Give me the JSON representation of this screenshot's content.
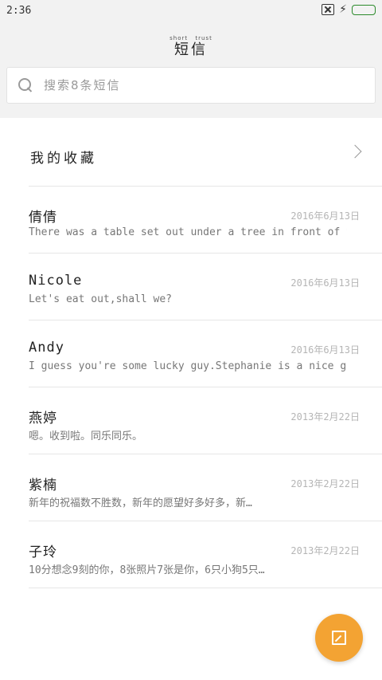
{
  "status_bar": {
    "time": "2:36"
  },
  "header": {
    "title": "短信",
    "title_ruby": "short trust"
  },
  "search": {
    "placeholder": "搜索8条短信"
  },
  "favorites": {
    "label": "我的收藏"
  },
  "messages": [
    {
      "name": "倩倩",
      "date": "2016年6月13日",
      "preview": "There was a table set out under a tree in front of the hous"
    },
    {
      "name": "Nicole",
      "date": "2016年6月13日",
      "preview": "Let's eat out,shall we?"
    },
    {
      "name": "Andy",
      "date": "2016年6月13日",
      "preview": "I guess you're some lucky guy.Stephanie is a nice girl."
    },
    {
      "name": "燕婷",
      "date": "2013年2月22日",
      "preview": "嗯。收到啦。同乐同乐。"
    },
    {
      "name": "紫楠",
      "date": "2013年2月22日",
      "preview": "新年的祝福数不胜数，新年的愿望好多好多，新…"
    },
    {
      "name": "子玲",
      "date": "2013年2月22日",
      "preview": "10分想念9刻的你，8张照片7张是你，6只小狗5只…"
    }
  ],
  "colors": {
    "accent": "#f3a333",
    "header_bg": "#f2f2f2",
    "battery": "#38c738"
  },
  "icons": {
    "search": "search-icon",
    "chevron": "chevron-right-icon",
    "compose": "compose-icon"
  }
}
